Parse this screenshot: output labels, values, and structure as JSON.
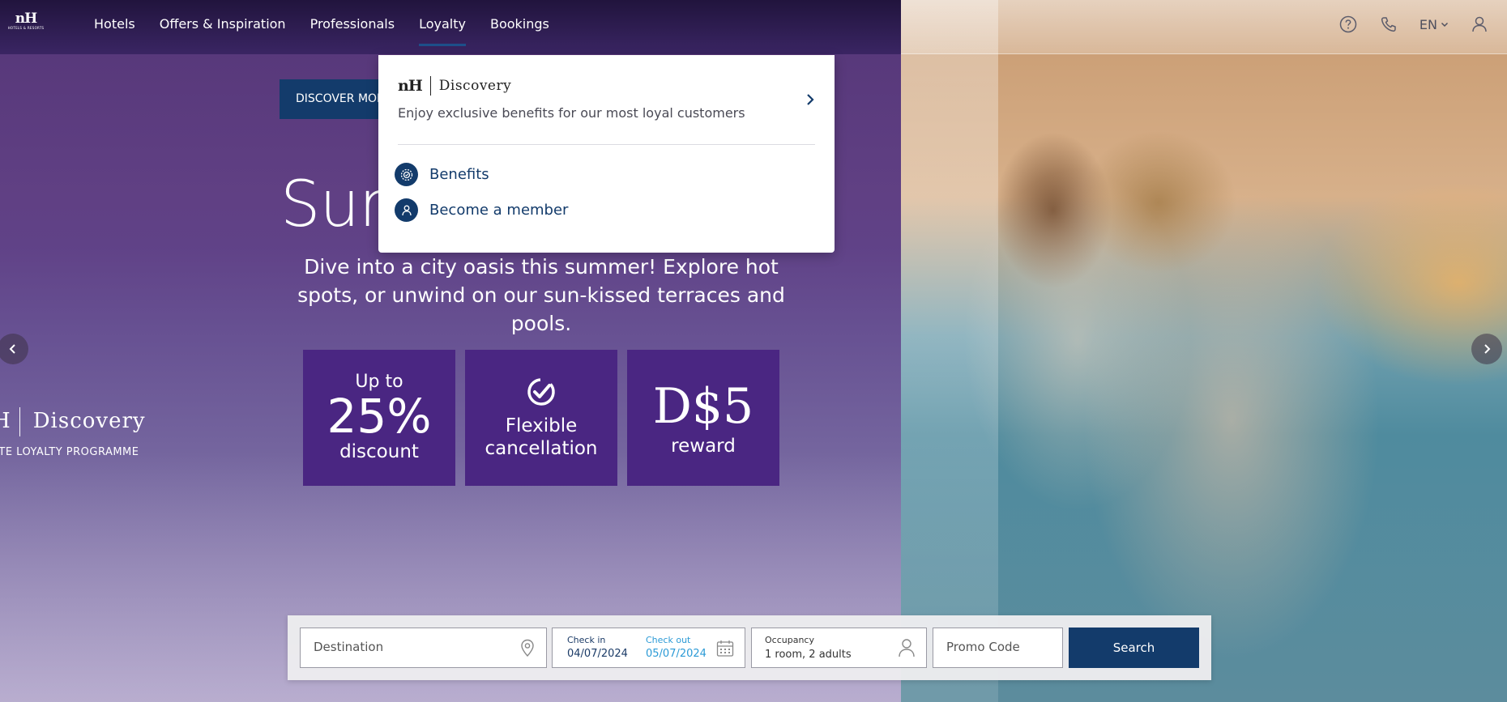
{
  "header": {
    "logo_text": "nH",
    "logo_subtext": "HOTELS & RESORTS",
    "nav": [
      {
        "label": "Hotels"
      },
      {
        "label": "Offers & Inspiration"
      },
      {
        "label": "Professionals"
      },
      {
        "label": "Loyalty"
      },
      {
        "label": "Bookings"
      }
    ],
    "language": "EN",
    "icons": [
      "help-icon",
      "phone-icon",
      "chevron-down-icon",
      "user-icon"
    ]
  },
  "hero": {
    "discover_button": "DISCOVER MORE",
    "title": "Summer",
    "subtitle": "Dive into a city oasis this summer! Explore hot spots, or unwind on our sun-kissed terraces and pools.",
    "features": [
      {
        "top": "Up to",
        "big": "25%",
        "bottom": "discount"
      },
      {
        "line1": "Flexible",
        "line2": "cancellation",
        "icon": "checkmark-circle-icon"
      },
      {
        "big": "D$5",
        "bottom": "reward"
      }
    ],
    "side_logo": "H",
    "side_brand": "Discovery",
    "side_tagline": "ATE LOYALTY PROGRAMME"
  },
  "dropdown": {
    "logo_nh": "nH",
    "logo_discovery": "Discovery",
    "description": "Enjoy exclusive benefits for our most loyal customers",
    "links": [
      {
        "label": "Benefits",
        "icon": "benefits-badge-icon"
      },
      {
        "label": "Become a member",
        "icon": "member-icon"
      }
    ]
  },
  "booking": {
    "destination_placeholder": "Destination",
    "checkin_label": "Check in",
    "checkin_value": "04/07/2024",
    "checkout_label": "Check out",
    "checkout_value": "05/07/2024",
    "occupancy_label": "Occupancy",
    "occupancy_value": "1 room, 2 adults",
    "promo_placeholder": "Promo Code",
    "search_label": "Search"
  },
  "colors": {
    "brand_navy": "#133b6b",
    "purple_panel": "#4a2682",
    "checkout_accent": "#2b9ad6"
  }
}
